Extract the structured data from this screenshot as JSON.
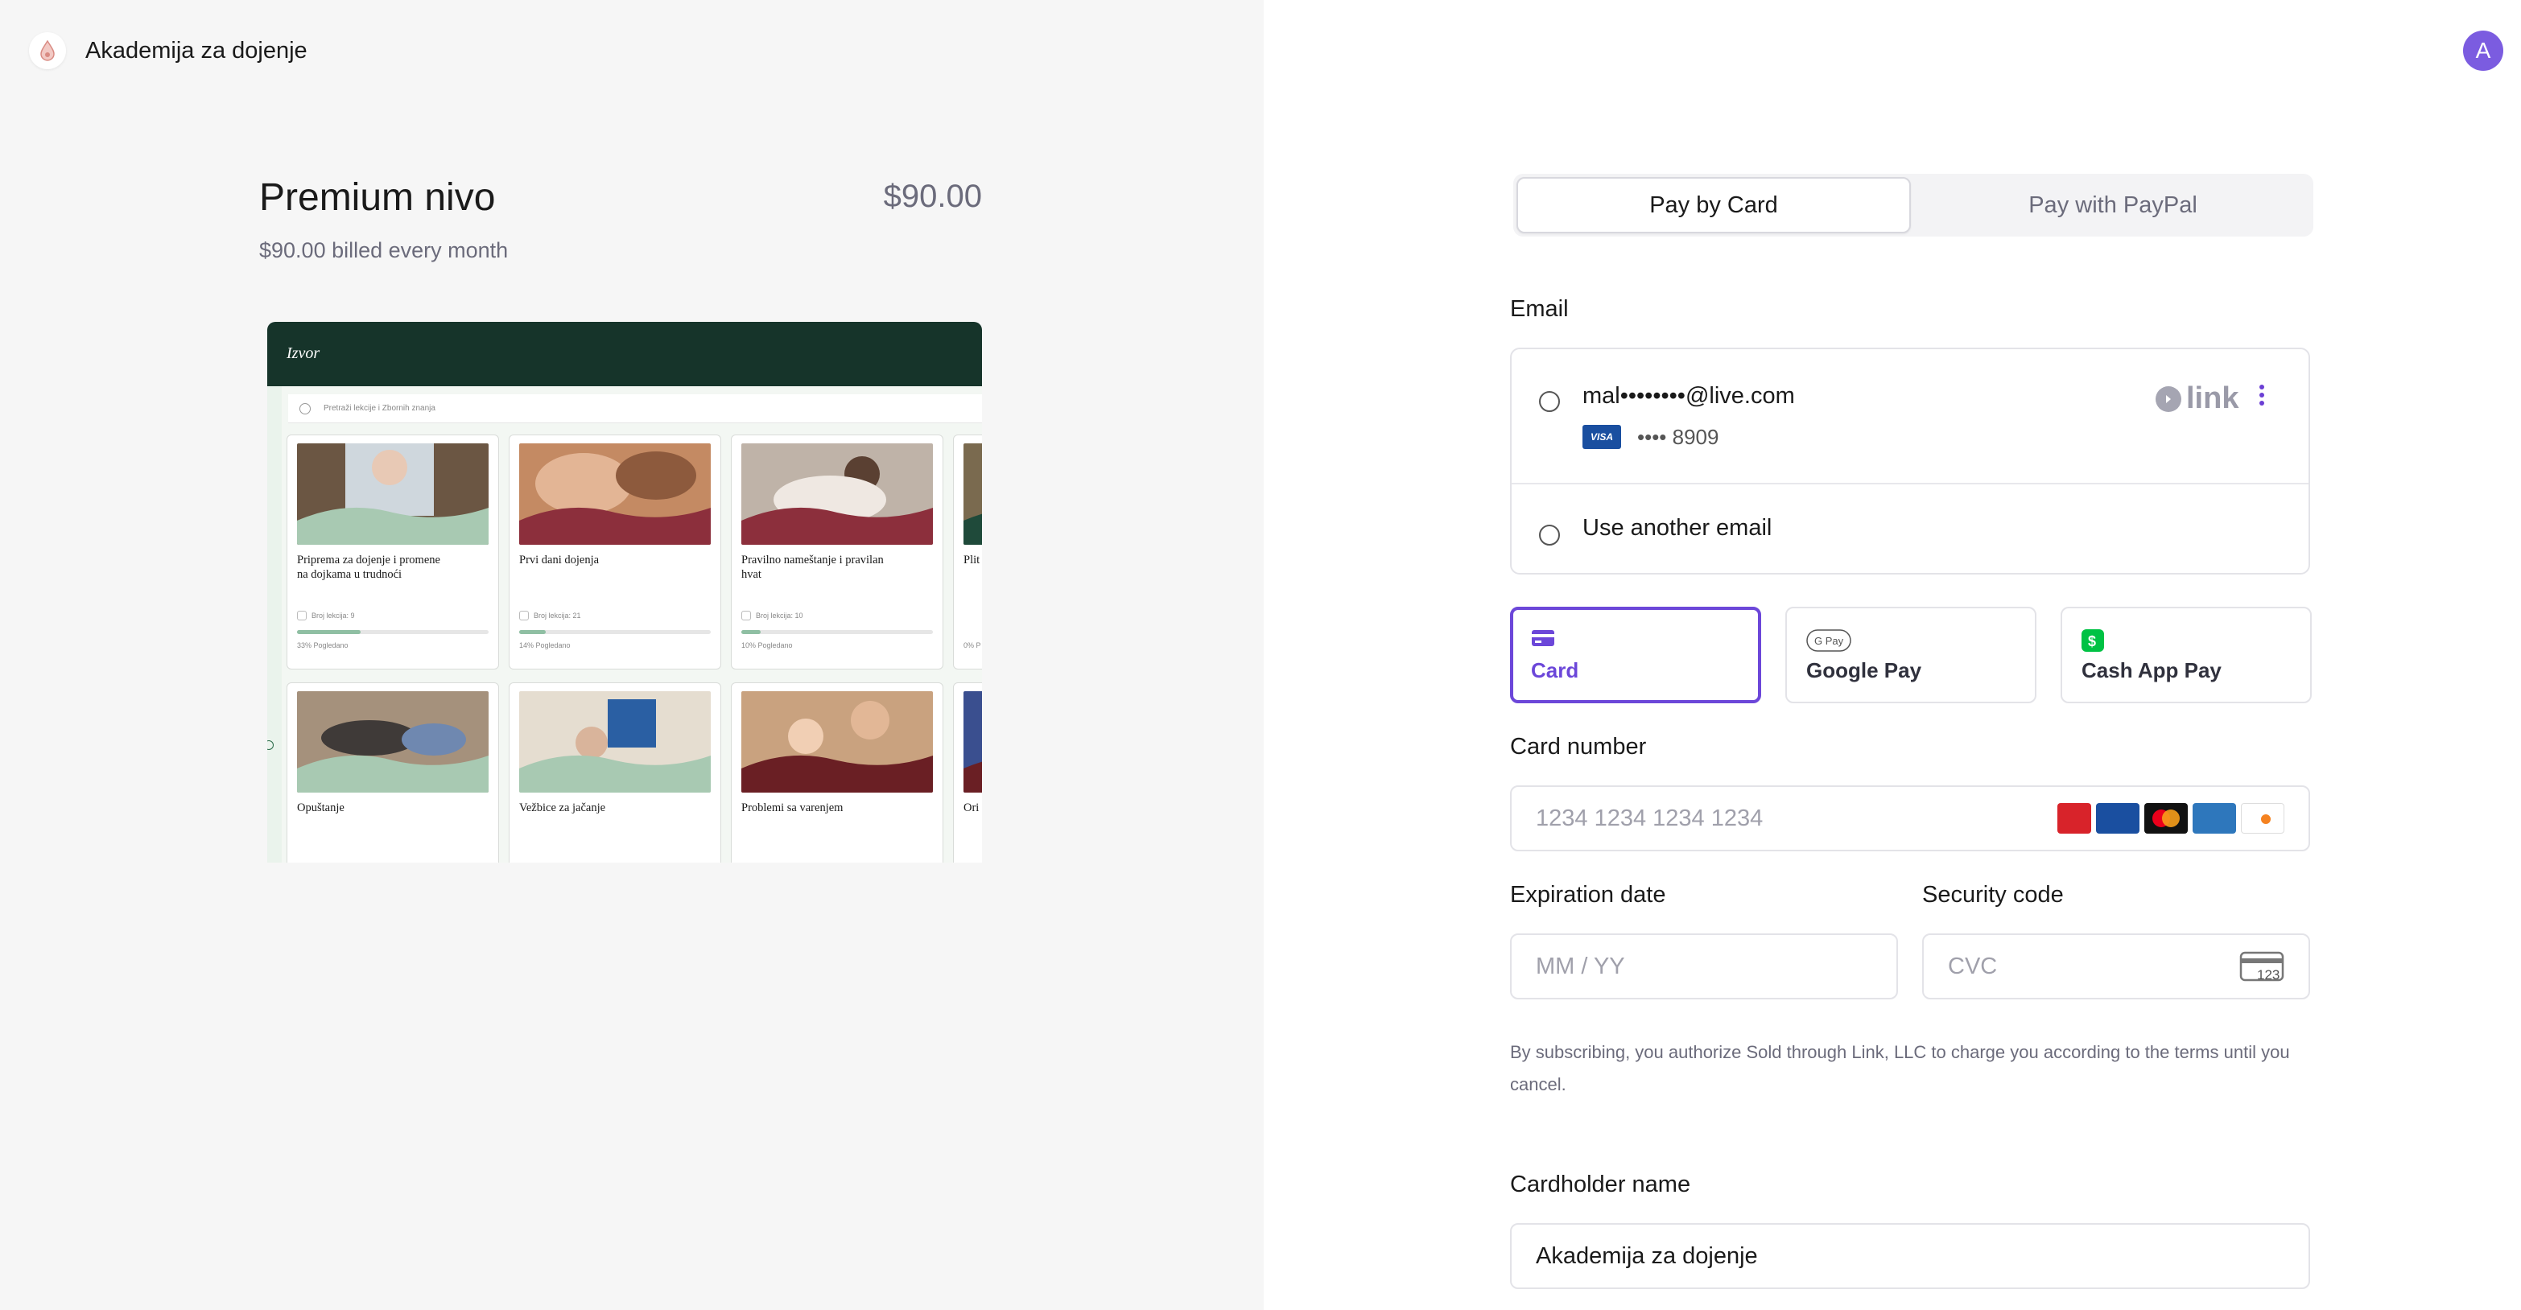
{
  "brand": {
    "name": "Akademija za dojenje"
  },
  "product": {
    "title": "Premium nivo",
    "price": "$90.00",
    "billing": "$90.00 billed every month",
    "preview": {
      "header_title": "Izvor",
      "search_placeholder": "Pretraži lekcije i Zbornih znanja",
      "courses": [
        {
          "title": "Priprema za dojenje i promene na dojkama u trudnoći",
          "meta": "Broj lekcija: 9",
          "progress_pct": 33,
          "progress_label": "33% Pogledano"
        },
        {
          "title": "Prvi dani dojenja",
          "meta": "Broj lekcija: 21",
          "progress_pct": 14,
          "progress_label": "14% Pogledano"
        },
        {
          "title": "Pravilno nameštanje i pravilan hvat",
          "meta": "Broj lekcija: 10",
          "progress_pct": 10,
          "progress_label": "10% Pogledano"
        },
        {
          "title": "Plit",
          "meta": "",
          "progress_pct": 0,
          "progress_label": "0% P"
        },
        {
          "title": "Opuštanje"
        },
        {
          "title": "Vežbice za jačanje"
        },
        {
          "title": "Problemi sa varenjem"
        },
        {
          "title": "Ori kra"
        }
      ]
    }
  },
  "account": {
    "avatar_letter": "A"
  },
  "payment": {
    "tabs": {
      "card": "Pay by Card",
      "paypal": "Pay with PayPal"
    },
    "email_label": "Email",
    "saved_email": "mal••••••••@live.com",
    "saved_card_brand": "VISA",
    "saved_card_last4": "•••• 8909",
    "link_label": "link",
    "use_another_email": "Use another email",
    "methods": {
      "card": "Card",
      "google_pay": "Google Pay",
      "cash_app": "Cash App Pay"
    },
    "card_number_label": "Card number",
    "card_number_placeholder": "1234 1234 1234 1234",
    "expiration_label": "Expiration date",
    "expiration_placeholder": "MM / YY",
    "security_label": "Security code",
    "security_placeholder": "CVC",
    "cvc_icon_text": "123",
    "terms": "By subscribing, you authorize Sold through Link, LLC to charge you according to the terms until you cancel.",
    "cardholder_label": "Cardholder name",
    "cardholder_value": "Akademija za dojenje"
  },
  "colors": {
    "accent": "#6c47d9",
    "dark_green": "#16342a",
    "muted": "#6b6b7b"
  }
}
